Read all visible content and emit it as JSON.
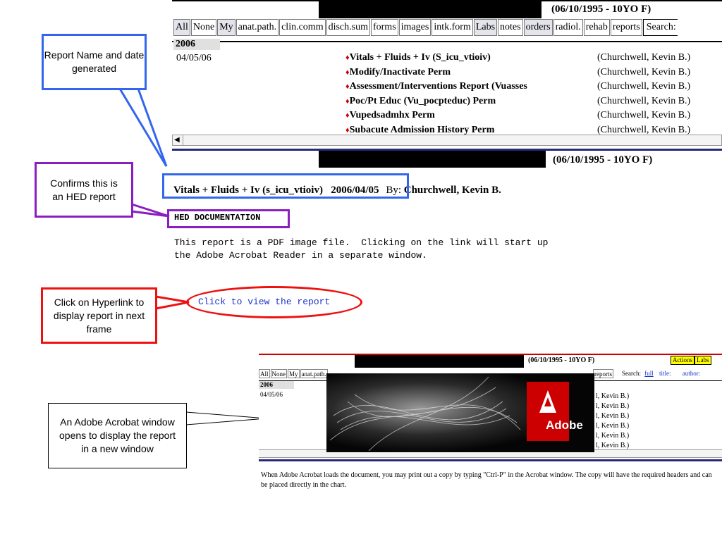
{
  "top_frame": {
    "patient": "(06/10/1995 - 10YO F)",
    "tabs": [
      "All",
      "None",
      "My",
      "anat.path.",
      "clin.comm",
      "disch.sum",
      "forms",
      "images",
      "intk.form",
      "Labs",
      "notes",
      "orders",
      "radiol.",
      "rehab",
      "reports",
      "Search:"
    ],
    "year": "2006",
    "date": "04/05/06",
    "reports": [
      {
        "name": "Vitals + Fluids + Iv (S_icu_vtioiv)",
        "author": "(Churchwell, Kevin B.)"
      },
      {
        "name": "Modify/Inactivate Perm",
        "author": "(Churchwell, Kevin B.)"
      },
      {
        "name": "Assessment/Interventions Report (Vuasses",
        "author": "(Churchwell, Kevin B.)"
      },
      {
        "name": "Poc/Pt Educ (Vu_pocpteduc) Perm",
        "author": "(Churchwell, Kevin B.)"
      },
      {
        "name": "Vupedsadmhx Perm",
        "author": "(Churchwell, Kevin B.)"
      },
      {
        "name": "Subacute Admission History Perm",
        "author": "(Churchwell, Kevin B.)"
      }
    ],
    "diamond": "♦"
  },
  "report_frame": {
    "patient": "(06/10/1995 - 10YO F)",
    "title": "Vitals + Fluids + Iv (s_icu_vtioiv)   2006/04/05",
    "by_label": "By:",
    "by_name": "Churchwell, Kevin B.",
    "hed": "HED DOCUMENTATION",
    "desc": "This report is a PDF image file.  Clicking on the link will start up\nthe Adobe Acrobat Reader in a separate window.",
    "link": "Click to view the report"
  },
  "callouts": {
    "report_name": "Report Name and date generated",
    "confirms": "Confirms this is an HED report",
    "click": "Click on Hyperlink to display report in next frame",
    "acrobat": "An Adobe Acrobat window opens to display the report in a new window"
  },
  "mini_screen": {
    "patient": "(06/10/1995 - 10YO F)",
    "actions": "Actions",
    "labs": "Labs",
    "tabs": [
      "All",
      "None",
      "My",
      "anat.path."
    ],
    "right_tabs": [
      "reports"
    ],
    "search": "Search:",
    "search_links": [
      "full",
      "title:",
      "author:"
    ],
    "year": "2006",
    "date": "04/05/06",
    "authors": [
      "l, Kevin B.)",
      "l, Kevin B.)",
      "l, Kevin B.)",
      "l, Kevin B.)",
      "l, Kevin B.)",
      "l, Kevin B.)"
    ],
    "adobe": "Adobe",
    "caption": "When Adobe Acrobat loads the document, you may print out a copy by typing \"Ctrl-P\" in the Acrobat window. The copy will have the required headers and can be placed directly in the chart."
  },
  "colors": {
    "callout_blue": "#3366ee",
    "callout_purple": "#8a1fc1",
    "callout_red": "#ee1111",
    "link_blue": "#1a33cc",
    "diamond_red": "#cc0000"
  }
}
